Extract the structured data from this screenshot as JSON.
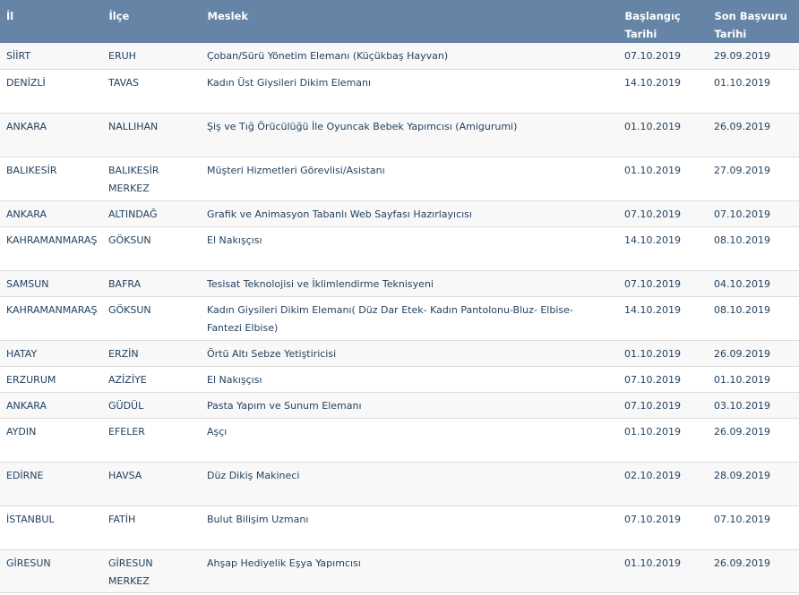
{
  "table": {
    "headers": {
      "il": "İl",
      "ilce": "İlçe",
      "meslek": "Meslek",
      "baslangic_1": "Başlangıç",
      "baslangic_2": "Tarihi",
      "son_1": "Son Başvuru",
      "son_2": "Tarihi"
    },
    "rows": [
      {
        "il": "SİİRT",
        "ilce": "ERUH",
        "ilce2": "",
        "meslek": "Çoban/Sürü Yönetim Elemanı (Küçükbaş Hayvan)",
        "meslek2": "",
        "baslangic": "07.10.2019",
        "son": "29.09.2019"
      },
      {
        "il": "DENİZLİ",
        "ilce": "TAVAS",
        "ilce2": "",
        "meslek": "Kadın Üst Giysileri Dikim Elemanı",
        "meslek2": "",
        "baslangic": "14.10.2019",
        "son": "01.10.2019"
      },
      {
        "il": "ANKARA",
        "ilce": "NALLIHAN",
        "ilce2": "",
        "meslek": "Şiş ve Tığ Örücülüğü İle Oyuncak Bebek Yapımcısı (Amigurumi)",
        "meslek2": "",
        "baslangic": "01.10.2019",
        "son": "26.09.2019"
      },
      {
        "il": "BALIKESİR",
        "ilce": "BALIKESİR",
        "ilce2": "MERKEZ",
        "meslek": "Müşteri Hizmetleri Görevlisi/Asistanı",
        "meslek2": "",
        "baslangic": "01.10.2019",
        "son": "27.09.2019"
      },
      {
        "il": "ANKARA",
        "ilce": "ALTINDAĞ",
        "ilce2": "",
        "meslek": "Grafik ve Animasyon Tabanlı Web Sayfası Hazırlayıcısı",
        "meslek2": "",
        "baslangic": "07.10.2019",
        "son": "07.10.2019"
      },
      {
        "il": "KAHRAMANMARAŞ",
        "ilce": "GÖKSUN",
        "ilce2": "",
        "meslek": "El Nakışçısı",
        "meslek2": "",
        "baslangic": "14.10.2019",
        "son": "08.10.2019"
      },
      {
        "il": "SAMSUN",
        "ilce": "BAFRA",
        "ilce2": "",
        "meslek": "Tesisat Teknolojisi ve İklimlendirme Teknisyeni",
        "meslek2": "",
        "baslangic": "07.10.2019",
        "son": "04.10.2019"
      },
      {
        "il": "KAHRAMANMARAŞ",
        "ilce": "GÖKSUN",
        "ilce2": "",
        "meslek": "Kadın Giysileri Dikim Elemanı( Düz Dar Etek- Kadın Pantolonu-Bluz- Elbise-",
        "meslek2": "Fantezi Elbise)",
        "baslangic": "14.10.2019",
        "son": "08.10.2019"
      },
      {
        "il": "HATAY",
        "ilce": "ERZİN",
        "ilce2": "",
        "meslek": "Örtü Altı Sebze Yetiştiricisi",
        "meslek2": "",
        "baslangic": "01.10.2019",
        "son": "26.09.2019"
      },
      {
        "il": "ERZURUM",
        "ilce": "AZİZİYE",
        "ilce2": "",
        "meslek": "El Nakışçısı",
        "meslek2": "",
        "baslangic": "07.10.2019",
        "son": "01.10.2019"
      },
      {
        "il": "ANKARA",
        "ilce": "GÜDÜL",
        "ilce2": "",
        "meslek": "Pasta Yapım ve Sunum Elemanı",
        "meslek2": "",
        "baslangic": "07.10.2019",
        "son": "03.10.2019"
      },
      {
        "il": "AYDIN",
        "ilce": "EFELER",
        "ilce2": "",
        "meslek": "Aşçı",
        "meslek2": "",
        "baslangic": "01.10.2019",
        "son": "26.09.2019"
      },
      {
        "il": "EDİRNE",
        "ilce": "HAVSA",
        "ilce2": "",
        "meslek": "Düz Dikiş Makineci",
        "meslek2": "",
        "baslangic": "02.10.2019",
        "son": "28.09.2019"
      },
      {
        "il": "İSTANBUL",
        "ilce": "FATİH",
        "ilce2": "",
        "meslek": "Bulut Bilişim Uzmanı",
        "meslek2": "",
        "baslangic": "07.10.2019",
        "son": "07.10.2019"
      },
      {
        "il": "GİRESUN",
        "ilce": "GİRESUN",
        "ilce2": "MERKEZ",
        "meslek": "Ahşap Hediyelik Eşya Yapımcısı",
        "meslek2": "",
        "baslangic": "01.10.2019",
        "son": "26.09.2019"
      }
    ]
  }
}
